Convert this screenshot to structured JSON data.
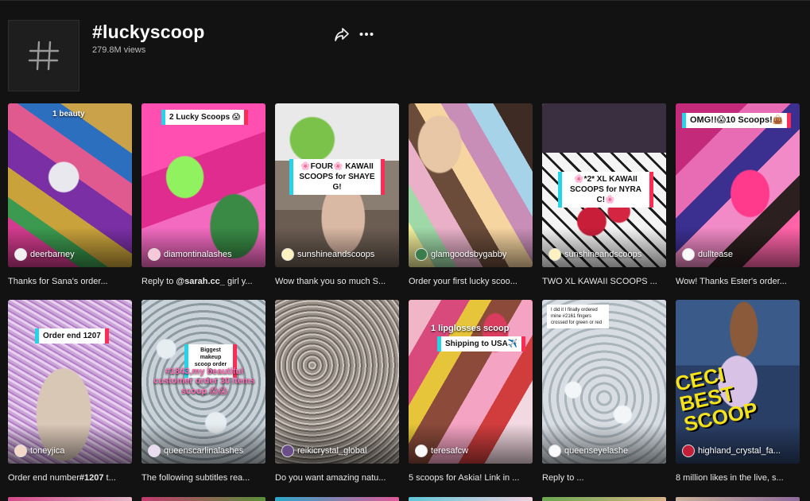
{
  "header": {
    "icon": "hashtag-icon",
    "title": "#luckyscoop",
    "views": "279.8M views",
    "share_icon": "share-icon",
    "more_icon": "more-options-icon"
  },
  "videos": [
    {
      "author": "deerbarney",
      "caption": "Thanks for Sana's order...",
      "overlay": "1 beauty"
    },
    {
      "author": "diamontinalashes",
      "caption_prefix": "Reply to ",
      "caption_bold": "@sarah.cc_",
      "caption_suffix": " girl y...",
      "overlay": "2 Lucky Scoops 😱"
    },
    {
      "author": "sunshineandscoops",
      "caption": "Wow thank you so much S...",
      "overlay": "🌸FOUR🌸 KAWAII SCOOPS for SHAYE G!"
    },
    {
      "author": "glamgoodsbygabby",
      "caption": "Order your first lucky scoo...",
      "overlay": ""
    },
    {
      "author": "sunshineandscoops",
      "caption": "TWO XL KAWAII SCOOPS ...",
      "overlay": "🌸*2* XL KAWAII SCOOPS for NYRA C!🌸"
    },
    {
      "author": "dulltease",
      "caption": "Wow! Thanks Ester's order...",
      "overlay": "OMG!!😱10 Scoops!👜"
    },
    {
      "author": "toneyjica",
      "caption_prefix": "Order end number",
      "caption_bold": "#1207",
      "caption_suffix": " t...",
      "overlay": "Order end 1207"
    },
    {
      "author": "queenscarlinalashes",
      "caption": "The following subtitles rea...",
      "overlay": "Biggest makeup scoop order😱",
      "overlay2": "#1843,my beautiful customer order 30 items scoop 😱😱"
    },
    {
      "author": "reikicrystal_global",
      "caption": "Do you want amazing natu...",
      "overlay": ""
    },
    {
      "author": "teresafcw",
      "caption": "5 scoops for Askia! Link in ...",
      "overlay": "Shipping to USA✈️",
      "overlay2": "1 lipglosses scoop"
    },
    {
      "author": "queenseyelashe",
      "caption": "Reply to ...",
      "overlay": "I did it I finally ordered mine #2161 fingers crossed for green or red"
    },
    {
      "author": "highland_crystal_fa...",
      "caption": "8 million likes in the live, s...",
      "overlay": "CECI BEST SCOOP"
    }
  ],
  "colors": {
    "background": "#121212",
    "tiktok_cyan": "#25d4e8",
    "tiktok_red": "#fe2c55"
  }
}
